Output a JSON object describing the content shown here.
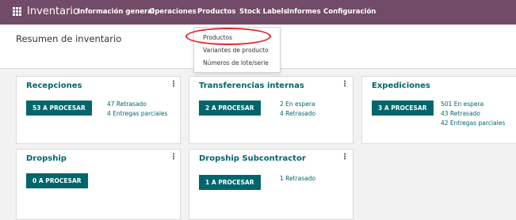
{
  "header": {
    "app_icon": "apps-grid-icon",
    "app_title": "Inventario",
    "menu": [
      "Información general",
      "Operaciones",
      "Productos",
      "Stock Labels",
      "Informes",
      "Configuración"
    ],
    "bg_color": "#714b67"
  },
  "page_title": "Resumen de inventario",
  "dropdown": {
    "items": [
      "Productos",
      "Variantes de producto",
      "Números de lote/serie"
    ],
    "highlight_color": "#e0242a"
  },
  "cards": [
    {
      "title": "Recepciones",
      "button": "53 A PROCESAR",
      "stats": [
        "47 Retrasado",
        "4 Entregas parciales"
      ]
    },
    {
      "title": "Transferencias internas",
      "button": "2 A PROCESAR",
      "stats": [
        "2 En espera",
        "4 Retrasado"
      ]
    },
    {
      "title": "Expediciones",
      "button": "3 A PROCESAR",
      "stats": [
        "501 En espera",
        "43 Retrasado",
        "42 Entregas parciales"
      ]
    },
    {
      "title": "Dropship",
      "button": "0 A PROCESAR",
      "stats": []
    },
    {
      "title": "Dropship Subcontractor",
      "button": "1 A PROCESAR",
      "stats": [
        "1 Retrasado"
      ]
    }
  ],
  "accent_color": "#01666b",
  "kebab_icon": "kebab-menu-icon"
}
